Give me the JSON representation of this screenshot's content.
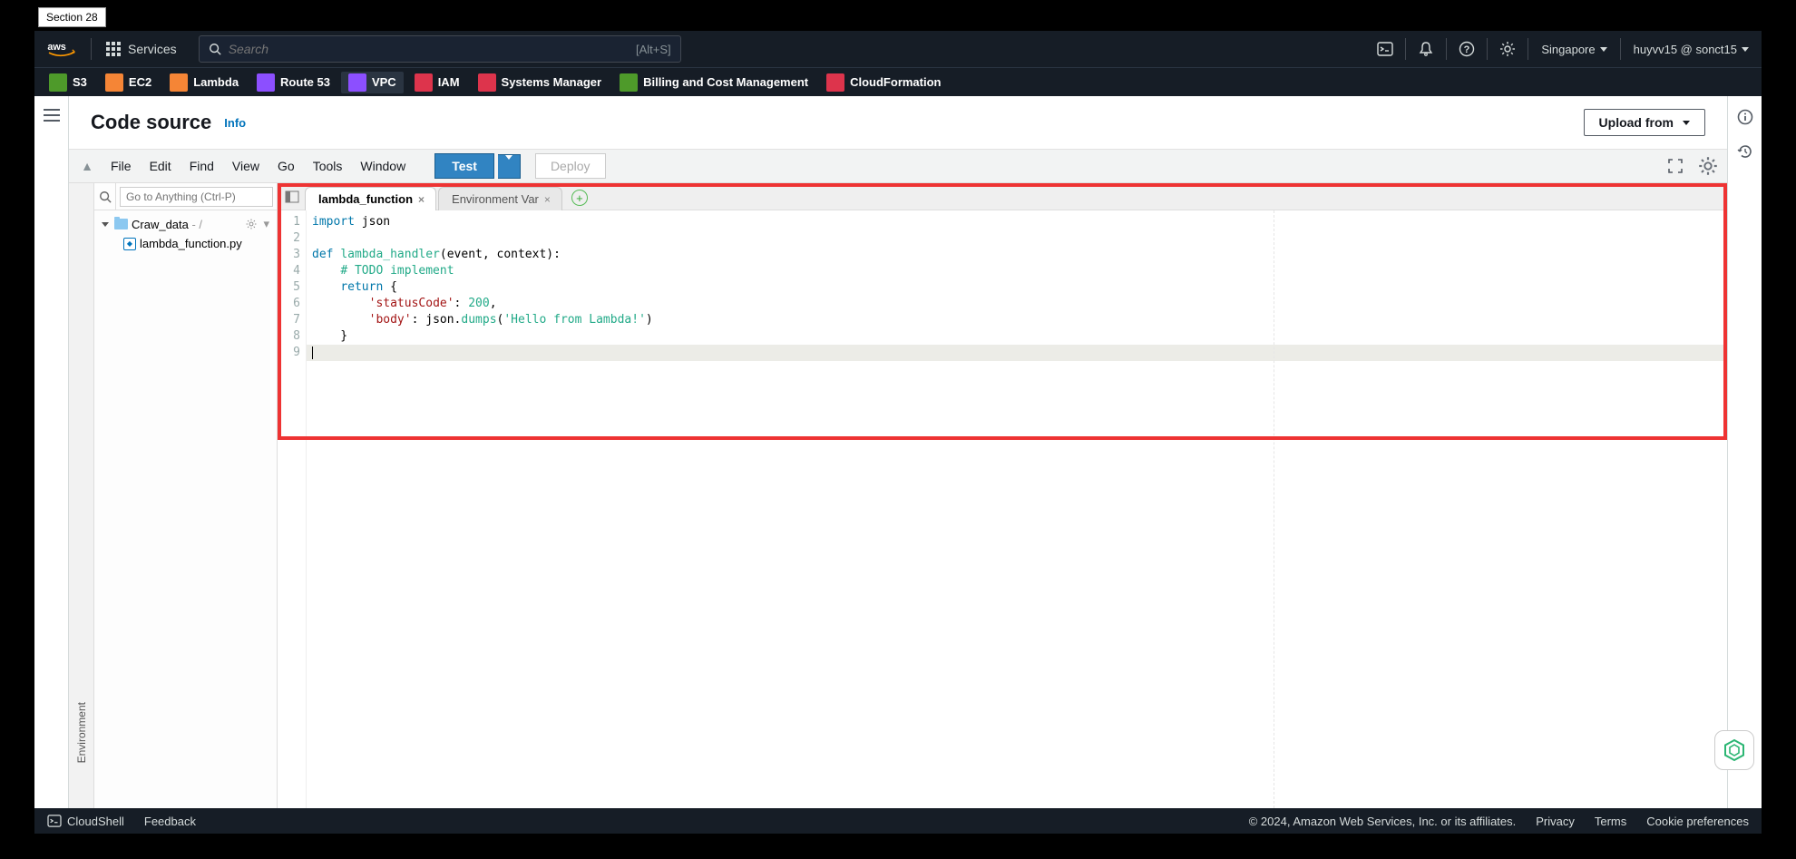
{
  "section_tag": "Section 28",
  "search": {
    "placeholder": "Search",
    "hint": "[Alt+S]"
  },
  "nav": {
    "services": "Services",
    "region": "Singapore",
    "account": "huyvv15 @ sonct15"
  },
  "service_bar": [
    {
      "label": "S3",
      "color": "#4e9a2a"
    },
    {
      "label": "EC2",
      "color": "#f58536"
    },
    {
      "label": "Lambda",
      "color": "#f58536"
    },
    {
      "label": "Route 53",
      "color": "#8c4fff"
    },
    {
      "label": "VPC",
      "color": "#8c4fff",
      "active": true
    },
    {
      "label": "IAM",
      "color": "#dd344c"
    },
    {
      "label": "Systems Manager",
      "color": "#dd344c"
    },
    {
      "label": "Billing and Cost Management",
      "color": "#4e9a2a"
    },
    {
      "label": "CloudFormation",
      "color": "#dd344c"
    }
  ],
  "page": {
    "title": "Code source",
    "info": "Info",
    "upload": "Upload from"
  },
  "ide_menu": [
    "File",
    "Edit",
    "Find",
    "View",
    "Go",
    "Tools",
    "Window"
  ],
  "buttons": {
    "test": "Test",
    "deploy": "Deploy"
  },
  "file_pane": {
    "goto_placeholder": "Go to Anything (Ctrl-P)",
    "root_folder": "Craw_data",
    "root_suffix": " - /",
    "files": [
      "lambda_function.py"
    ]
  },
  "env_tab": "Environment",
  "tabs": [
    {
      "label": "lambda_function",
      "active": true
    },
    {
      "label": "Environment Var",
      "active": false
    }
  ],
  "code": {
    "lines": [
      "1",
      "2",
      "3",
      "4",
      "5",
      "6",
      "7",
      "8",
      "9"
    ],
    "src": [
      [
        [
          "kw",
          "import"
        ],
        [
          "",
          " json"
        ]
      ],
      [],
      [
        [
          "def",
          "def"
        ],
        [
          "",
          " "
        ],
        [
          "fn",
          "lambda_handler"
        ],
        [
          "",
          "(event, context):"
        ]
      ],
      [
        [
          "",
          "    "
        ],
        [
          "cmt",
          "# TODO implement"
        ]
      ],
      [
        [
          "",
          "    "
        ],
        [
          "kw",
          "return"
        ],
        [
          "",
          " {"
        ]
      ],
      [
        [
          "",
          "        "
        ],
        [
          "str",
          "'statusCode'"
        ],
        [
          "",
          ": "
        ],
        [
          "num",
          "200"
        ],
        [
          "",
          ","
        ]
      ],
      [
        [
          "",
          "        "
        ],
        [
          "str",
          "'body'"
        ],
        [
          "",
          ": json."
        ],
        [
          "fn",
          "dumps"
        ],
        [
          "",
          "("
        ],
        [
          "str2",
          "'Hello from Lambda!'"
        ],
        [
          "",
          ")"
        ]
      ],
      [
        [
          "",
          "    }"
        ]
      ],
      []
    ],
    "active_line_index": 8
  },
  "bottom": {
    "cloudshell": "CloudShell",
    "feedback": "Feedback",
    "copyright": "© 2024, Amazon Web Services, Inc. or its affiliates.",
    "privacy": "Privacy",
    "terms": "Terms",
    "cookie": "Cookie preferences"
  }
}
